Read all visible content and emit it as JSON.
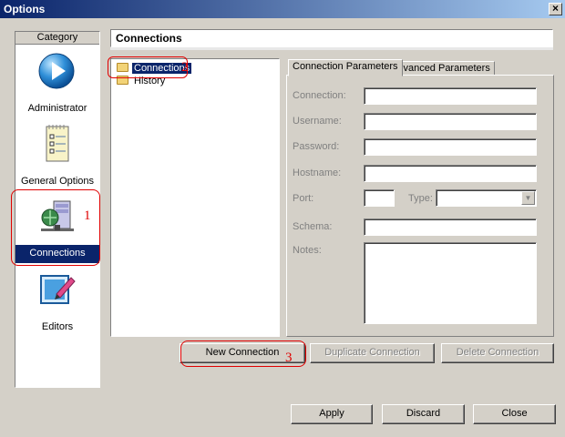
{
  "window": {
    "title": "Options",
    "close_glyph": "×"
  },
  "category": {
    "header": "Category",
    "items": [
      {
        "label": "Administrator",
        "icon": "administrator-icon"
      },
      {
        "label": "General Options",
        "icon": "general-options-icon"
      },
      {
        "label": "Connections",
        "icon": "connections-icon",
        "selected": true
      },
      {
        "label": "Editors",
        "icon": "editors-icon"
      }
    ]
  },
  "panel": {
    "title": "Connections"
  },
  "tree": {
    "items": [
      {
        "label": "Connections",
        "selected": true
      },
      {
        "label": "History"
      }
    ]
  },
  "tabs": [
    {
      "label": "Connection Parameters",
      "active": true
    },
    {
      "label": "Advanced Parameters"
    }
  ],
  "form": {
    "connection_label": "Connection:",
    "username_label": "Username:",
    "password_label": "Password:",
    "hostname_label": "Hostname:",
    "port_label": "Port:",
    "type_label": "Type:",
    "schema_label": "Schema:",
    "notes_label": "Notes:"
  },
  "actions": {
    "new_connection": "New Connection",
    "duplicate_connection": "Duplicate Connection",
    "delete_connection": "Delete Connection"
  },
  "footer": {
    "apply": "Apply",
    "discard": "Discard",
    "close": "Close"
  },
  "annotations": [
    "1",
    "2",
    "3"
  ],
  "colors": {
    "selection": "#0a246a",
    "annotation": "#e00000",
    "face": "#d4d0c8"
  }
}
